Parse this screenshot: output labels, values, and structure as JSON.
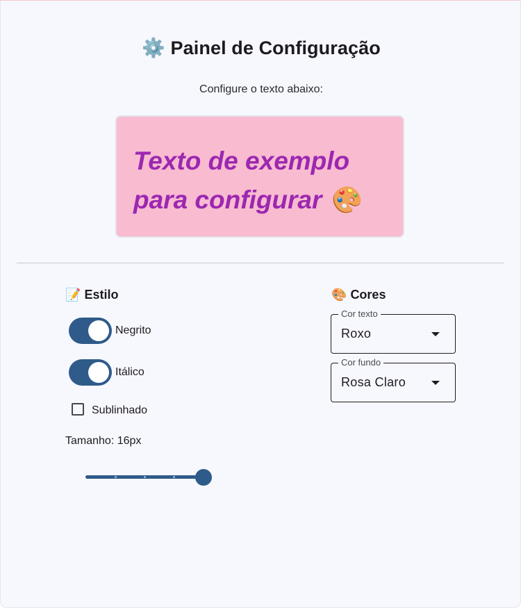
{
  "header": {
    "icon": "⚙️",
    "title": "Painel de Configuração",
    "subtitle": "Configure o texto abaixo:"
  },
  "preview": {
    "text": "Texto de exemplo para configurar 🎨",
    "text_color": "#9c27b0",
    "background_color": "#f8bbd0"
  },
  "style_section": {
    "icon": "📝",
    "title": "Estilo",
    "bold": {
      "label": "Negrito",
      "on": true
    },
    "italic": {
      "label": "Itálico",
      "on": true
    },
    "underline": {
      "label": "Sublinhado",
      "checked": false
    },
    "size_label": "Tamanho: 16px",
    "size_value": 16,
    "slider_fraction": 1.0
  },
  "colors_section": {
    "icon": "🎨",
    "title": "Cores",
    "text_color_field": {
      "label": "Cor texto",
      "value": "Roxo"
    },
    "background_field": {
      "label": "Cor fundo",
      "value": "Rosa Claro"
    }
  },
  "accent": "#2f5b8a"
}
